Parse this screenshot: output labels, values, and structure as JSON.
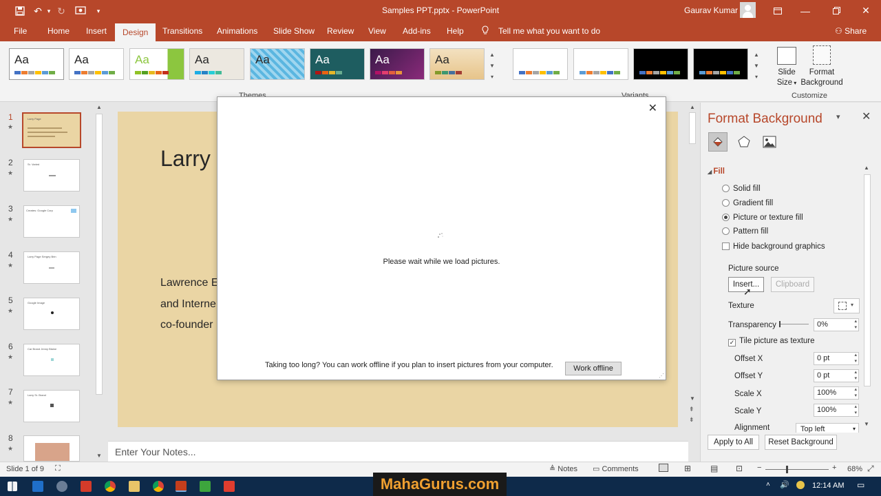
{
  "titlebar": {
    "title": "Samples PPT.pptx  -  PowerPoint",
    "user": "Gaurav Kumar",
    "qat_icons": [
      "save-icon",
      "undo-icon",
      "redo-icon",
      "start-from-beginning-icon",
      "customize-icon"
    ]
  },
  "tabs": [
    "File",
    "Home",
    "Insert",
    "Design",
    "Transitions",
    "Animations",
    "Slide Show",
    "Review",
    "View",
    "Add-ins",
    "Help"
  ],
  "active_tab": "Design",
  "tell_me": "Tell me what you want to do",
  "share": "Share",
  "ribbon": {
    "themes_label": "Themes",
    "variants_label": "Variants",
    "customize_label": "Customize",
    "theme_aa": "Aa",
    "slide_size": "Slide Size",
    "slide_size_l1": "Slide",
    "slide_size_l2": "Size",
    "format_bg_l1": "Format",
    "format_bg_l2": "Background"
  },
  "slides": {
    "numbers": [
      "1",
      "2",
      "3",
      "4",
      "5",
      "6",
      "7",
      "8"
    ],
    "thumb_texts": [
      "Larry Page",
      "Sr. Varied",
      "Creates: Google Corp",
      "Larry Page Sergey Brin",
      "Google Image",
      "Car Brand Jenny Blaine",
      "Larry Sr. Brand",
      ""
    ]
  },
  "slide": {
    "title": "Larry",
    "body_lines": [
      "Lawrence E",
      "and Interne",
      "co-founder"
    ]
  },
  "notes_placeholder": "Enter Your Notes...",
  "dialog": {
    "wait_text": "Please wait while we load pictures.",
    "offline_text": "Taking too long? You can work offline if you plan to insert pictures from your computer.",
    "offline_button": "Work offline"
  },
  "pane": {
    "title": "Format Background",
    "section": "Fill",
    "fill_options": [
      "Solid fill",
      "Gradient fill",
      "Picture or texture fill",
      "Pattern fill"
    ],
    "selected_fill": "Picture or texture fill",
    "hide_bg": "Hide background graphics",
    "hide_bg_checked": false,
    "picture_source": "Picture source",
    "insert_button": "Insert...",
    "clipboard_button": "Clipboard",
    "texture": "Texture",
    "transparency": "Transparency",
    "transparency_value": "0%",
    "tile_label": "Tile picture as texture",
    "tile_checked": true,
    "offset_x_label": "Offset X",
    "offset_x": "0 pt",
    "offset_y_label": "Offset Y",
    "offset_y": "0 pt",
    "scale_x_label": "Scale X",
    "scale_x": "100%",
    "scale_y_label": "Scale Y",
    "scale_y": "100%",
    "alignment_label": "Alignment",
    "alignment": "Top left",
    "apply_all": "Apply to All",
    "reset": "Reset Background"
  },
  "statusbar": {
    "slide_info": "Slide 1 of 9",
    "notes": "Notes",
    "comments": "Comments",
    "zoom": "68%"
  },
  "taskbar": {
    "time": "12:14 AM",
    "watermark": "MahaGurus.com"
  },
  "colors": {
    "accent": "#b7472a",
    "slide_bg": "#ead5a4"
  }
}
